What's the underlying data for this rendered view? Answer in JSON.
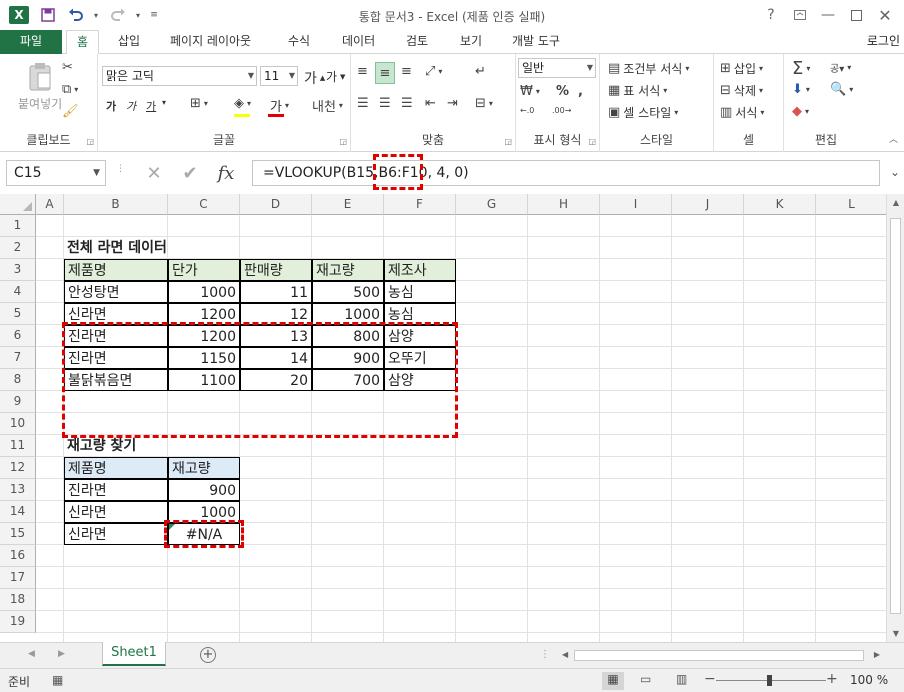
{
  "window": {
    "title": "통합 문서3 - Excel (제품 인증 실패)",
    "help": "?",
    "app_logo": "X"
  },
  "tabs": {
    "file": "파일",
    "items": [
      "홈",
      "삽입",
      "페이지 레이아웃",
      "수식",
      "데이터",
      "검토",
      "보기",
      "개발 도구"
    ],
    "login": "로그인"
  },
  "ribbon": {
    "clipboard": {
      "label": "클립보드",
      "paste": "붙여넣기"
    },
    "font": {
      "label": "글꼴",
      "name": "맑은 고딕",
      "size": "11",
      "bold": "가",
      "italic": "가",
      "underline": "가"
    },
    "alignment": {
      "label": "맞춤"
    },
    "number": {
      "label": "표시 형식",
      "format": "일반"
    },
    "styles": {
      "label": "스타일",
      "conditional": "조건부 서식",
      "table": "표 서식",
      "cell": "셀 스타일"
    },
    "cells": {
      "label": "셀",
      "insert": "삽입",
      "delete": "삭제",
      "format": "서식"
    },
    "editing": {
      "label": "편집"
    }
  },
  "formula_bar": {
    "name_box": "C15",
    "fx": "fx",
    "formula": "=VLOOKUP(B15,B6:F10, 4, 0)"
  },
  "grid": {
    "columns": [
      "A",
      "B",
      "C",
      "D",
      "E",
      "F",
      "G",
      "H",
      "I",
      "J",
      "K",
      "L"
    ],
    "rows": [
      "1",
      "2",
      "3",
      "4",
      "5",
      "6",
      "7",
      "8",
      "9",
      "10",
      "11",
      "12",
      "13",
      "14",
      "15",
      "16",
      "17",
      "18",
      "19"
    ],
    "table1": {
      "title": "전체 라면 데이터",
      "headers": [
        "제품명",
        "단가",
        "판매량",
        "재고량",
        "제조사"
      ],
      "rows": [
        [
          "안성탕면",
          "1000",
          "11",
          "500",
          "농심"
        ],
        [
          "신라면",
          "1200",
          "12",
          "1000",
          "농심"
        ],
        [
          "진라면",
          "1200",
          "13",
          "800",
          "삼양"
        ],
        [
          "진라면",
          "1150",
          "14",
          "900",
          "오뚜기"
        ],
        [
          "불닭볶음면",
          "1100",
          "20",
          "700",
          "삼양"
        ]
      ]
    },
    "table2": {
      "title": "재고량 찾기",
      "headers": [
        "제품명",
        "재고량"
      ],
      "rows": [
        [
          "진라면",
          "900"
        ],
        [
          "신라면",
          "1000"
        ],
        [
          "신라면",
          "#N/A"
        ]
      ]
    }
  },
  "sheets": {
    "active": "Sheet1"
  },
  "status": {
    "text": "준비",
    "zoom": "100 %"
  },
  "colors": {
    "accent": "#217346",
    "highlight": "#e00000",
    "header_green": "#e2efda",
    "header_blue": "#ddebf7"
  }
}
